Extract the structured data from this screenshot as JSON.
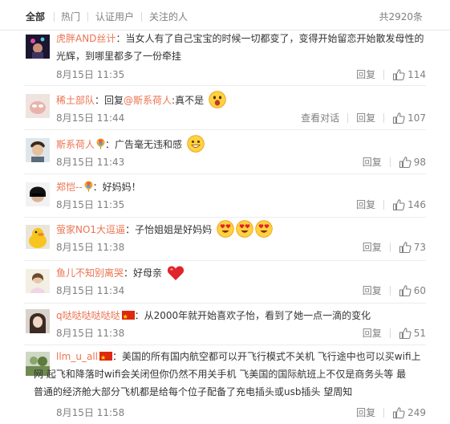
{
  "tabs": {
    "all": "全部",
    "hot": "热门",
    "verified": "认证用户",
    "following": "关注的人",
    "total": "共2920条"
  },
  "comments": [
    {
      "user": "虎胖AND丝计",
      "body_line1": "：当女人有了自己宝宝的时候一切都变了，变得开始留恋开始散发母性的",
      "body_line2": "光辉，到哪里都多了一份牵挂",
      "time": "8月15日 11:35",
      "reply": "回复",
      "likes": "114"
    },
    {
      "user": "稀土部队",
      "reply_prefix": "：回复",
      "mention": "@斯系荷人",
      "body": ":真不是",
      "time": "8月15日 11:44",
      "view_thread": "查看对话",
      "reply": "回复",
      "likes": "107"
    },
    {
      "user": "斯系荷人",
      "body": "：广告毫无违和感",
      "time": "8月15日 11:43",
      "reply": "回复",
      "likes": "98"
    },
    {
      "user": "郑恺--",
      "body": "：好妈妈！",
      "time": "8月15日 11:35",
      "reply": "回复",
      "likes": "146"
    },
    {
      "user": "萤家NO1大逗逼",
      "body": "：子怡姐姐是好妈妈",
      "time": "8月15日 11:38",
      "reply": "回复",
      "likes": "73"
    },
    {
      "user": "鱼儿不知别离哭",
      "body": "：好母亲",
      "time": "8月15日 11:34",
      "reply": "回复",
      "likes": "60"
    },
    {
      "user": "q哒哒哒哒哒哒",
      "body": "：从2000年就开始喜欢子怡，看到了她一点一滴的变化",
      "time": "8月15日 11:38",
      "reply": "回复",
      "likes": "51"
    },
    {
      "user": "llm_u_all",
      "body_line1": "：美国的所有国内航空都可以开飞行模式不关机 飞行途中也可以买wifi上",
      "body_line2": "网 起飞和降落时wifi会关闭但你仍然不用关手机 飞美国的国际航班上不仅是商务头等 最",
      "body_line3": "普通的经济舱大部分飞机都是给每个位子配备了充电插头或usb插头 望周知",
      "time": "8月15日 11:58",
      "reply": "回复",
      "likes": "249"
    }
  ],
  "colors": {
    "username": "#eb7350",
    "meta": "#808080",
    "text": "#333333",
    "divider": "#ececec"
  },
  "icons": {
    "like": "thumbs-up-icon",
    "badge": "colorful-balloon-badge-icon",
    "flag": "china-flag-icon",
    "emoji_shocked": "shocked-face-emoji",
    "emoji_grin": "grinning-face-emoji",
    "emoji_heart_eyes": "heart-eyes-emoji",
    "emoji_heart": "red-heart-emoji"
  }
}
